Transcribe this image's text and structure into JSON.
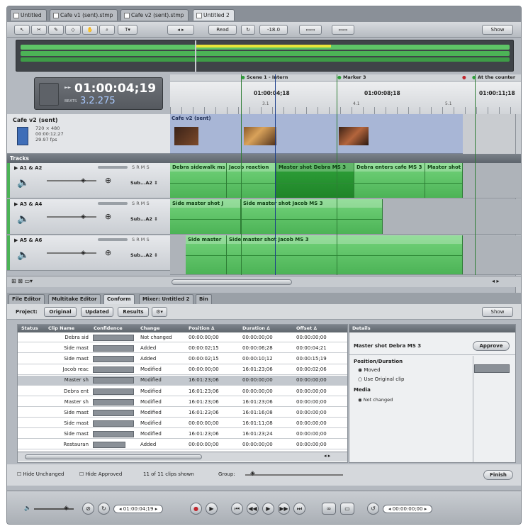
{
  "document_tabs": [
    "Untitled",
    "Cafe v1 (sent).stmp",
    "Cafe v2 (sent).stmp",
    "Untitled 2"
  ],
  "toolbar": {
    "read_label": "Read",
    "level_value": "-18.0",
    "show_label": "Show"
  },
  "timecode": {
    "value": "01:00:04;19",
    "beats_label": "BEATS",
    "beats_value": "3.2.275"
  },
  "ruler": {
    "markers": [
      "Scene 1 - Intern",
      "Marker 3",
      "At the counter"
    ],
    "times": [
      "01:00:04;18",
      "01:00:08;18",
      "01:00:11;18"
    ],
    "bars": [
      "3.1",
      "4.1",
      "5.1"
    ]
  },
  "clip_info": {
    "name": "Cafe v2 (sent)",
    "size": "720 × 480",
    "duration": "00:00:12;27",
    "fps": "29.97 fps"
  },
  "video_track_label": "Cafe v2 (sent)",
  "tracks_header": "Tracks",
  "tracks": [
    {
      "name": "A1 & A2",
      "flags": "S  R  M  S",
      "output": "Sub...A2",
      "clips": [
        "Debra sidewalk ms",
        "Jacob reaction",
        "Master shot Debra MS 3",
        "Debra enters cafe MS 3",
        "Master shot"
      ]
    },
    {
      "name": "A3 & A4",
      "flags": "S  R  M  S",
      "output": "Sub...A2",
      "clips": [
        "Side master shot J",
        "Side master shot Jacob MS 3"
      ]
    },
    {
      "name": "A5 & A6",
      "flags": "S  R  M  S",
      "output": "Sub...A2",
      "clips": [
        "Side master",
        "Side master shot Jacob MS 3"
      ]
    }
  ],
  "bottom_tabs": [
    "File Editor",
    "Multitake Editor",
    "Conform",
    "Mixer: Untitled 2",
    "Bin"
  ],
  "project": {
    "label": "Project:",
    "original": "Original",
    "updated": "Updated",
    "results": "Results",
    "show_label": "Show"
  },
  "conform_table": {
    "columns": [
      "Status",
      "Clip Name",
      "Confidence",
      "Change",
      "Position ∆",
      "Duration ∆",
      "Offset ∆"
    ],
    "rows": [
      {
        "name": "Debra sid",
        "confidence": 1.0,
        "change": "Not changed",
        "position": "00:00:00;00",
        "duration": "00:00:00;00",
        "offset": "00:00:00;00"
      },
      {
        "name": "Side mast",
        "confidence": 1.0,
        "change": "Added",
        "position": "00:00:02;15",
        "duration": "00:00:06;28",
        "offset": "00:00:04;21"
      },
      {
        "name": "Side mast",
        "confidence": 1.0,
        "change": "Added",
        "position": "00:00:02;15",
        "duration": "00:00:10;12",
        "offset": "00:00:15;19"
      },
      {
        "name": "Jacob reac",
        "confidence": 1.0,
        "change": "Modified",
        "position": "00:00:00;00",
        "duration": "16:01:23;06",
        "offset": "00:00:02;06"
      },
      {
        "name": "Master sh",
        "confidence": 1.0,
        "change": "Modified",
        "position": "16:01:23;06",
        "duration": "00:00:00;00",
        "offset": "00:00:00;00"
      },
      {
        "name": "Debra ent",
        "confidence": 1.0,
        "change": "Modified",
        "position": "16:01:23;06",
        "duration": "00:00:00;00",
        "offset": "00:00:00;00"
      },
      {
        "name": "Master sh",
        "confidence": 1.0,
        "change": "Modified",
        "position": "16:01:23;06",
        "duration": "16:01:23;06",
        "offset": "00:00:00;00"
      },
      {
        "name": "Side mast",
        "confidence": 1.0,
        "change": "Modified",
        "position": "16:01:23;06",
        "duration": "16:01:16;08",
        "offset": "00:00:00;00"
      },
      {
        "name": "Side mast",
        "confidence": 1.0,
        "change": "Modified",
        "position": "00:00:00;00",
        "duration": "16:01:11;08",
        "offset": "00:00:00;00"
      },
      {
        "name": "Side mast",
        "confidence": 1.0,
        "change": "Modified",
        "position": "16:01:23;06",
        "duration": "16:01:23;24",
        "offset": "00:00:00;00"
      },
      {
        "name": "Restauran",
        "confidence": 0.8,
        "change": "Added",
        "position": "00:00:00;00",
        "duration": "00:00:00;00",
        "offset": "00:00:00;00"
      }
    ]
  },
  "details": {
    "header": "Details",
    "clip": "Master shot Debra MS 3",
    "approve": "Approve",
    "position_duration": "Position/Duration",
    "moved": "Moved",
    "use_original": "Use Original clip",
    "media": "Media",
    "not_changed": "Not changed"
  },
  "footer": {
    "hide_unchanged": "Hide Unchanged",
    "hide_approved": "Hide Approved",
    "count": "11 of 11 clips shown",
    "group": "Group:",
    "finish": "Finish"
  },
  "transport": {
    "timecode": "01:00:04;19",
    "duration": "00:00:00;00"
  }
}
